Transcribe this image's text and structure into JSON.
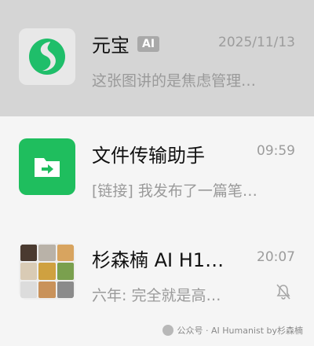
{
  "chats": [
    {
      "name": "元宝",
      "badge": "AI",
      "time": "2025/11/13",
      "preview": "这张图讲的是焦虑管理…",
      "avatar_icon": "yuanbao-logo-icon",
      "avatar_bg": "#e8e8e8",
      "accent": "#1fbe6a",
      "selected": true
    },
    {
      "name": "文件传输助手",
      "time": "09:59",
      "preview": "[链接] 我发布了一篇笔…",
      "avatar_icon": "folder-arrow-icon",
      "avatar_bg": "#1fbe5e"
    },
    {
      "name": "杉森楠 AI H1…",
      "time": "20:07",
      "preview": "六年: 完全就是高…",
      "avatar_icon": "group-photo-grid",
      "muted": true,
      "mute_icon": "bell-slash-icon"
    }
  ],
  "watermark": {
    "text": "公众号 · AI Humanist by杉森楠",
    "icon": "wechat-official-account-icon"
  }
}
